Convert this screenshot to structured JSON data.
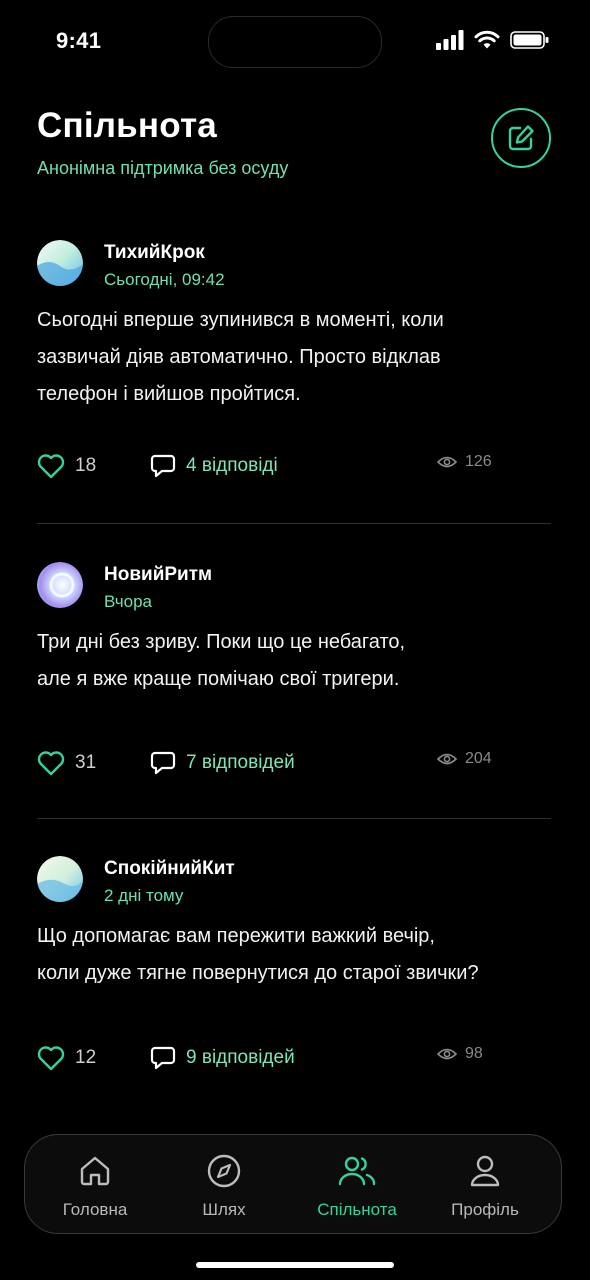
{
  "status_bar": {
    "time": "9:41"
  },
  "header": {
    "title": "Спільнота",
    "subtitle": "Анонімна підтримка без осуду",
    "compose_icon": "compose-icon"
  },
  "posts": [
    {
      "author": "ТихийКрок",
      "time": "Сьогодні, 09:42",
      "lines": [
        "Сьогодні вперше зупинився в моменті, коли",
        "зазвичай діяв автоматично. Просто відклав",
        "телефон і вийшов пройтися."
      ],
      "likes": "18",
      "replies": "4 відповіді",
      "views": "126"
    },
    {
      "author": "НовийРитм",
      "time": "Вчора",
      "lines": [
        "Три дні без зриву. Поки що це небагато,",
        "але я вже краще помічаю свої тригери."
      ],
      "likes": "31",
      "replies": "7 відповідей",
      "views": "204"
    },
    {
      "author": "СпокійнийКит",
      "time": "2 дні тому",
      "lines": [
        "Що допомагає вам пережити важкий вечір,",
        "коли дуже тягне повернутися до старої звички?"
      ],
      "likes": "12",
      "replies": "9 відповідей",
      "views": "98"
    }
  ],
  "tabbar": {
    "items": [
      {
        "label": "Головна",
        "icon": "home-icon",
        "active": false
      },
      {
        "label": "Шлях",
        "icon": "compass-icon",
        "active": false
      },
      {
        "label": "Спільнота",
        "icon": "users-icon",
        "active": true
      },
      {
        "label": "Профіль",
        "icon": "user-icon",
        "active": false
      }
    ]
  },
  "colors": {
    "accent": "#35d399",
    "accent_text": "#6fdfae",
    "background": "#000000"
  }
}
